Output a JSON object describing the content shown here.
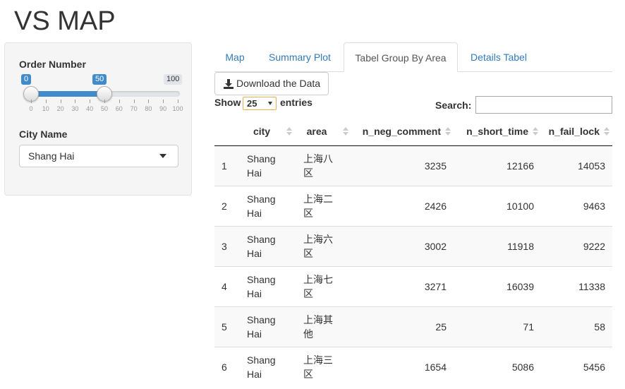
{
  "app": {
    "title": "VS MAP"
  },
  "sidebar": {
    "order_label": "Order Number",
    "slider": {
      "min": 0,
      "max": 100,
      "from": 0,
      "to": 50,
      "min_label": "0",
      "from_label": "0",
      "to_label": "50",
      "max_label": "100",
      "ticks": [
        "0",
        "10",
        "20",
        "30",
        "40",
        "50",
        "60",
        "70",
        "80",
        "90",
        "100"
      ]
    },
    "city_label": "City Name",
    "city_selected": "Shang Hai"
  },
  "tabs": [
    "Map",
    "Summary Plot",
    "Tabel Group By Area",
    "Details Tabel"
  ],
  "active_tab": "Tabel Group By Area",
  "download_label": "Download the Data",
  "table_controls": {
    "show_label": "Show",
    "entries_value": "25",
    "entries_label": "entries",
    "search_label": "Search:",
    "search_value": ""
  },
  "table": {
    "columns": [
      "",
      "city",
      "area",
      "n_neg_comment",
      "n_short_time",
      "n_fail_lock"
    ],
    "rows": [
      {
        "idx": "1",
        "city": [
          "Shang",
          "Hai"
        ],
        "area": [
          "上海八",
          "区"
        ],
        "n_neg_comment": "3235",
        "n_short_time": "12166",
        "n_fail_lock": "14053"
      },
      {
        "idx": "2",
        "city": [
          "Shang",
          "Hai"
        ],
        "area": [
          "上海二",
          "区"
        ],
        "n_neg_comment": "2426",
        "n_short_time": "10100",
        "n_fail_lock": "9463"
      },
      {
        "idx": "3",
        "city": [
          "Shang",
          "Hai"
        ],
        "area": [
          "上海六",
          "区"
        ],
        "n_neg_comment": "3002",
        "n_short_time": "11918",
        "n_fail_lock": "9222"
      },
      {
        "idx": "4",
        "city": [
          "Shang",
          "Hai"
        ],
        "area": [
          "上海七",
          "区"
        ],
        "n_neg_comment": "3271",
        "n_short_time": "16039",
        "n_fail_lock": "11338"
      },
      {
        "idx": "5",
        "city": [
          "Shang",
          "Hai"
        ],
        "area": [
          "上海其",
          "他"
        ],
        "n_neg_comment": "25",
        "n_short_time": "71",
        "n_fail_lock": "58"
      },
      {
        "idx": "6",
        "city": [
          "Shang",
          "Hai"
        ],
        "area": [
          "上海三",
          "区"
        ],
        "n_neg_comment": "1654",
        "n_short_time": "5086",
        "n_fail_lock": "5456"
      }
    ]
  },
  "colors": {
    "accent": "#428bca",
    "link": "#337ab7",
    "panel_bg": "#f5f5f5"
  }
}
